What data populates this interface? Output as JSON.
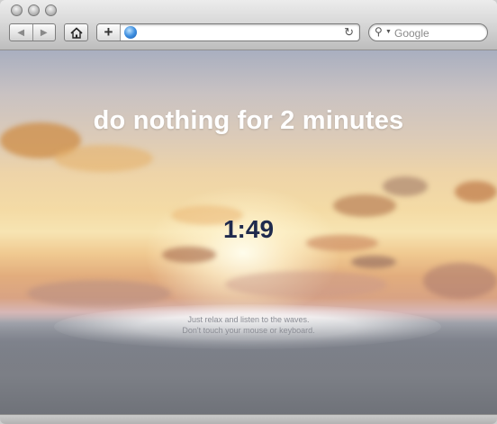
{
  "browser": {
    "address": {
      "value": "",
      "placeholder": ""
    },
    "search": {
      "placeholder": "Google"
    },
    "icons": {
      "back": "back-arrow-icon",
      "forward": "forward-arrow-icon",
      "home": "home-icon",
      "add_bookmark": "plus-icon",
      "site": "globe-icon",
      "reload": "reload-icon",
      "search": "magnifier-icon"
    }
  },
  "page": {
    "headline": "do nothing for 2 minutes",
    "timer": "1:49",
    "hint_line1": "Just relax and listen to the waves.",
    "hint_line2": "Don't touch your mouse or keyboard."
  },
  "colors": {
    "headline": "#ffffff",
    "timer": "#1f2a4d",
    "hint": "#8b8d95"
  }
}
